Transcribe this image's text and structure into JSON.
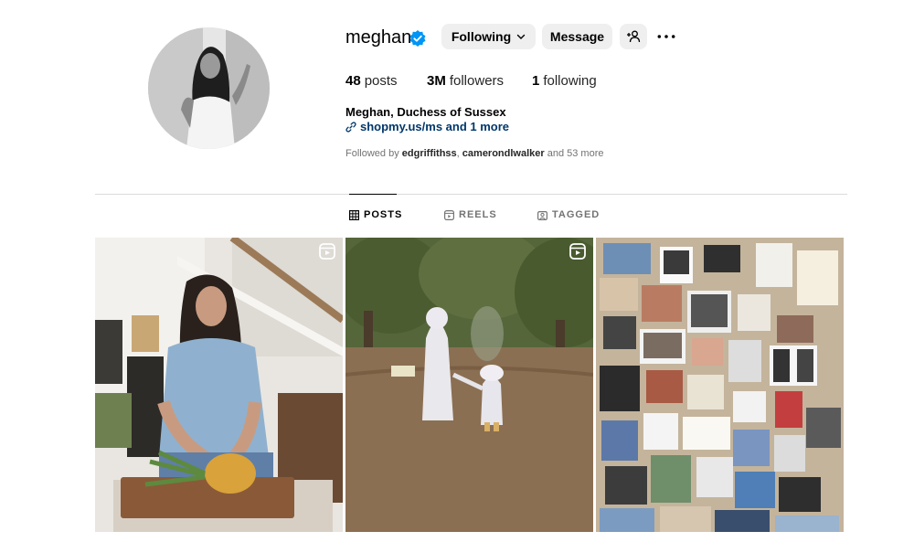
{
  "profile": {
    "username": "meghan",
    "full_name": "Meghan, Duchess of Sussex",
    "link_text": "shopmy.us/ms and 1 more",
    "followed_by_prefix": "Followed by",
    "followed_by_user1": "edgriffithss",
    "followed_by_user2": "camerondlwalker",
    "followed_by_suffix": "and 53 more"
  },
  "buttons": {
    "following": "Following",
    "message": "Message"
  },
  "stats": {
    "posts_count": "48",
    "posts_label": "posts",
    "followers_count": "3M",
    "followers_label": "followers",
    "following_count": "1",
    "following_label": "following"
  },
  "tabs": [
    {
      "label": "POSTS",
      "active": true
    },
    {
      "label": "REELS",
      "active": false
    },
    {
      "label": "TAGGED",
      "active": false
    }
  ],
  "icons": {
    "verified": "verified-badge-icon",
    "chevron": "chevron-down-icon",
    "suggest": "add-person-icon",
    "more": "more-options-icon",
    "link": "link-icon",
    "grid": "grid-icon",
    "reels": "reels-icon",
    "tagged": "tagged-icon"
  },
  "colors": {
    "verified_blue": "#0095f6",
    "link_blue": "#00376b",
    "button_gray": "#efefef"
  }
}
